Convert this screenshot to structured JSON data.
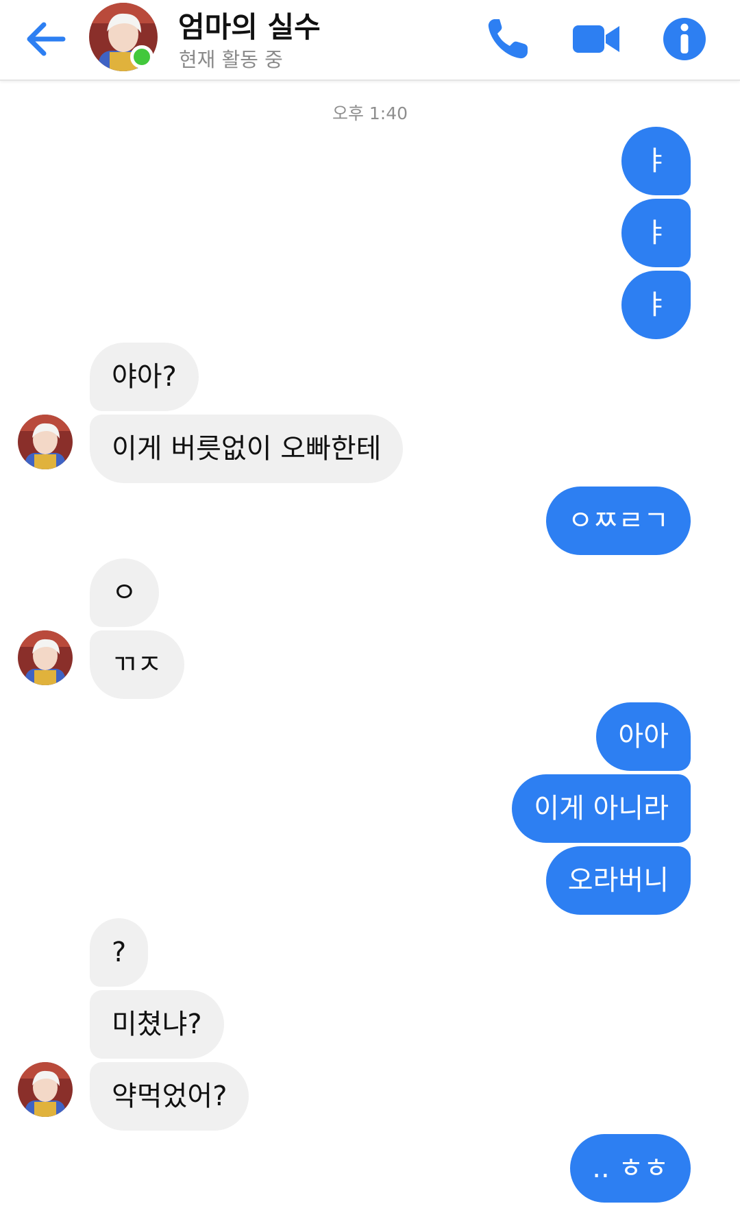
{
  "header": {
    "contact_name": "엄마의 실수",
    "status": "현재 활동 중",
    "back_icon": "arrow-left-icon",
    "call_icon": "phone-icon",
    "video_icon": "video-camera-icon",
    "info_icon": "info-icon"
  },
  "colors": {
    "accent": "#2d7ff2",
    "incoming_bubble": "#f0f0f0",
    "online": "#42c83c"
  },
  "thread": {
    "timestamp": "오후 1:40",
    "messages": [
      {
        "sender": "me",
        "text": "ㅑ"
      },
      {
        "sender": "me",
        "text": "ㅑ"
      },
      {
        "sender": "me",
        "text": "ㅑ"
      },
      {
        "sender": "contact",
        "text": "야아?"
      },
      {
        "sender": "contact",
        "text": "이게 버릇없이 오빠한테"
      },
      {
        "sender": "me",
        "text": "ㅇㅉㄹㄱ"
      },
      {
        "sender": "contact",
        "text": "ㅇ"
      },
      {
        "sender": "contact",
        "text": "ㄲㅈ"
      },
      {
        "sender": "me",
        "text": "아아"
      },
      {
        "sender": "me",
        "text": "이게 아니라"
      },
      {
        "sender": "me",
        "text": "오라버니"
      },
      {
        "sender": "contact",
        "text": "?"
      },
      {
        "sender": "contact",
        "text": "미쳤냐?"
      },
      {
        "sender": "contact",
        "text": "약먹었어?"
      },
      {
        "sender": "me",
        "text": ".. ㅎㅎ"
      }
    ]
  }
}
